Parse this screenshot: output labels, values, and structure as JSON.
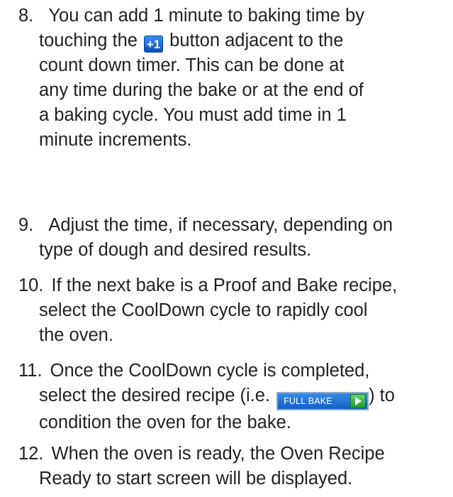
{
  "steps": [
    {
      "number": "8.",
      "lines": [
        "You can add 1 minute to baking time by",
        "touching the",
        "button adjacent to the",
        "count down timer. This can be done at",
        "any time during the bake or at the end of",
        "a baking cycle.  You must add time in 1",
        "minute increments."
      ],
      "icon_label": "+1"
    },
    {
      "number": "9.",
      "lines": [
        "Adjust the time, if necessary, depending on",
        "type of dough and desired results."
      ]
    },
    {
      "number": "10.",
      "lines": [
        "If the next bake is a Proof and Bake recipe,",
        "select the CoolDown cycle to rapidly cool",
        "the oven."
      ]
    },
    {
      "number": "11.",
      "lines": [
        "Once the CoolDown cycle is completed,",
        "select the desired recipe (i.e.",
        ") to",
        "condition the oven for the bake."
      ],
      "button_label": "FULL BAKE"
    },
    {
      "number": "12.",
      "lines": [
        "When the oven is ready, the Oven Recipe",
        "Ready to start screen will be displayed."
      ]
    }
  ],
  "colors": {
    "text": "#231f20",
    "icon_blue": "#1565d8",
    "play_green": "#2fae3c"
  }
}
